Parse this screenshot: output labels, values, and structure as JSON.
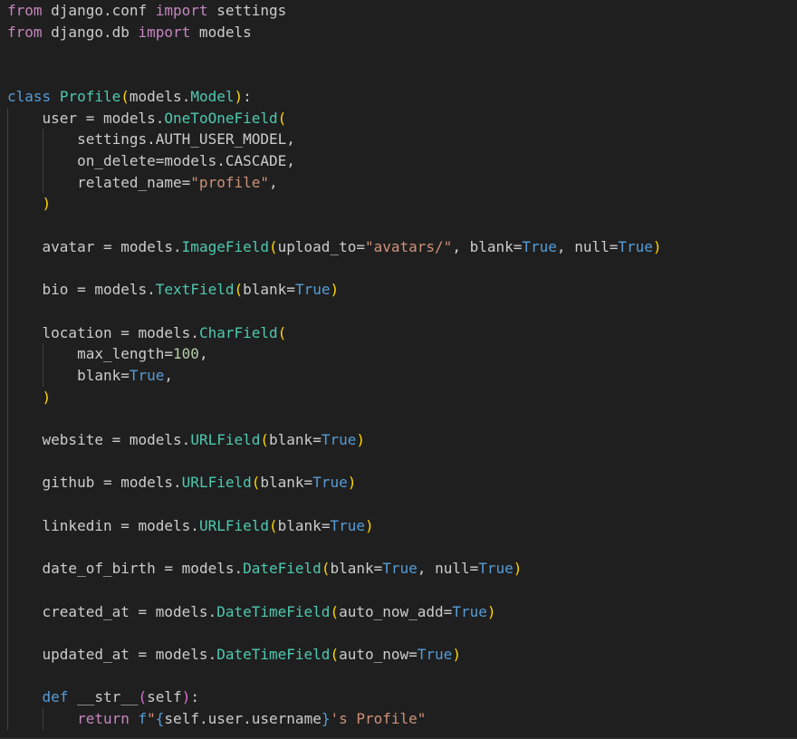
{
  "editor": {
    "colors": {
      "background": "#1f1f1f",
      "keyword": "#c586c0",
      "storage": "#569cd6",
      "text": "#cccccc",
      "variable": "#9cdcfe",
      "class_name": "#4ec9b0",
      "function": "#dcdcaa",
      "string": "#ce9178",
      "number": "#b5cea8",
      "bracket1": "#ffd700",
      "bracket2": "#da70d6",
      "indent_guide": "#404040"
    },
    "lines": [
      [
        [
          "from",
          "keyword"
        ],
        [
          " django.conf ",
          "text"
        ],
        [
          "import",
          "keyword"
        ],
        [
          " settings",
          "text"
        ]
      ],
      [
        [
          "from",
          "keyword"
        ],
        [
          " django.db ",
          "text"
        ],
        [
          "import",
          "keyword"
        ],
        [
          " models",
          "text"
        ]
      ],
      [],
      [],
      [
        [
          "class",
          "storage"
        ],
        [
          " ",
          "text"
        ],
        [
          "Profile",
          "class_name"
        ],
        [
          "(",
          "bracket1"
        ],
        [
          "models",
          "text"
        ],
        [
          ".",
          "text"
        ],
        [
          "Model",
          "class_name"
        ],
        [
          ")",
          "bracket1"
        ],
        [
          ":",
          "text"
        ]
      ],
      [
        [
          "    ",
          "text"
        ],
        [
          "user",
          "text"
        ],
        [
          " = ",
          "text"
        ],
        [
          "models",
          "text"
        ],
        [
          ".",
          "text"
        ],
        [
          "OneToOneField",
          "class_name"
        ],
        [
          "(",
          "bracket1"
        ]
      ],
      [
        [
          "        ",
          "text"
        ],
        [
          "settings",
          "text"
        ],
        [
          ".",
          "text"
        ],
        [
          "AUTH_USER_MODEL",
          "text"
        ],
        [
          ",",
          "text"
        ]
      ],
      [
        [
          "        ",
          "text"
        ],
        [
          "on_delete",
          "text"
        ],
        [
          "=",
          "text"
        ],
        [
          "models",
          "text"
        ],
        [
          ".",
          "text"
        ],
        [
          "CASCADE",
          "text"
        ],
        [
          ",",
          "text"
        ]
      ],
      [
        [
          "        ",
          "text"
        ],
        [
          "related_name",
          "text"
        ],
        [
          "=",
          "text"
        ],
        [
          "\"profile\"",
          "string"
        ],
        [
          ",",
          "text"
        ]
      ],
      [
        [
          "    ",
          "text"
        ],
        [
          ")",
          "bracket1"
        ]
      ],
      [],
      [
        [
          "    ",
          "text"
        ],
        [
          "avatar",
          "text"
        ],
        [
          " = ",
          "text"
        ],
        [
          "models",
          "text"
        ],
        [
          ".",
          "text"
        ],
        [
          "ImageField",
          "class_name"
        ],
        [
          "(",
          "bracket1"
        ],
        [
          "upload_to",
          "text"
        ],
        [
          "=",
          "text"
        ],
        [
          "\"avatars/\"",
          "string"
        ],
        [
          ", ",
          "text"
        ],
        [
          "blank",
          "text"
        ],
        [
          "=",
          "text"
        ],
        [
          "True",
          "storage"
        ],
        [
          ", ",
          "text"
        ],
        [
          "null",
          "text"
        ],
        [
          "=",
          "text"
        ],
        [
          "True",
          "storage"
        ],
        [
          ")",
          "bracket1"
        ]
      ],
      [],
      [
        [
          "    ",
          "text"
        ],
        [
          "bio",
          "text"
        ],
        [
          " = ",
          "text"
        ],
        [
          "models",
          "text"
        ],
        [
          ".",
          "text"
        ],
        [
          "TextField",
          "class_name"
        ],
        [
          "(",
          "bracket1"
        ],
        [
          "blank",
          "text"
        ],
        [
          "=",
          "text"
        ],
        [
          "True",
          "storage"
        ],
        [
          ")",
          "bracket1"
        ]
      ],
      [],
      [
        [
          "    ",
          "text"
        ],
        [
          "location",
          "text"
        ],
        [
          " = ",
          "text"
        ],
        [
          "models",
          "text"
        ],
        [
          ".",
          "text"
        ],
        [
          "CharField",
          "class_name"
        ],
        [
          "(",
          "bracket1"
        ]
      ],
      [
        [
          "        ",
          "text"
        ],
        [
          "max_length",
          "text"
        ],
        [
          "=",
          "text"
        ],
        [
          "100",
          "number"
        ],
        [
          ",",
          "text"
        ]
      ],
      [
        [
          "        ",
          "text"
        ],
        [
          "blank",
          "text"
        ],
        [
          "=",
          "text"
        ],
        [
          "True",
          "storage"
        ],
        [
          ",",
          "text"
        ]
      ],
      [
        [
          "    ",
          "text"
        ],
        [
          ")",
          "bracket1"
        ]
      ],
      [],
      [
        [
          "    ",
          "text"
        ],
        [
          "website",
          "text"
        ],
        [
          " = ",
          "text"
        ],
        [
          "models",
          "text"
        ],
        [
          ".",
          "text"
        ],
        [
          "URLField",
          "class_name"
        ],
        [
          "(",
          "bracket1"
        ],
        [
          "blank",
          "text"
        ],
        [
          "=",
          "text"
        ],
        [
          "True",
          "storage"
        ],
        [
          ")",
          "bracket1"
        ]
      ],
      [],
      [
        [
          "    ",
          "text"
        ],
        [
          "github",
          "text"
        ],
        [
          " = ",
          "text"
        ],
        [
          "models",
          "text"
        ],
        [
          ".",
          "text"
        ],
        [
          "URLField",
          "class_name"
        ],
        [
          "(",
          "bracket1"
        ],
        [
          "blank",
          "text"
        ],
        [
          "=",
          "text"
        ],
        [
          "True",
          "storage"
        ],
        [
          ")",
          "bracket1"
        ]
      ],
      [],
      [
        [
          "    ",
          "text"
        ],
        [
          "linkedin",
          "text"
        ],
        [
          " = ",
          "text"
        ],
        [
          "models",
          "text"
        ],
        [
          ".",
          "text"
        ],
        [
          "URLField",
          "class_name"
        ],
        [
          "(",
          "bracket1"
        ],
        [
          "blank",
          "text"
        ],
        [
          "=",
          "text"
        ],
        [
          "True",
          "storage"
        ],
        [
          ")",
          "bracket1"
        ]
      ],
      [],
      [
        [
          "    ",
          "text"
        ],
        [
          "date_of_birth",
          "text"
        ],
        [
          " = ",
          "text"
        ],
        [
          "models",
          "text"
        ],
        [
          ".",
          "text"
        ],
        [
          "DateField",
          "class_name"
        ],
        [
          "(",
          "bracket1"
        ],
        [
          "blank",
          "text"
        ],
        [
          "=",
          "text"
        ],
        [
          "True",
          "storage"
        ],
        [
          ", ",
          "text"
        ],
        [
          "null",
          "text"
        ],
        [
          "=",
          "text"
        ],
        [
          "True",
          "storage"
        ],
        [
          ")",
          "bracket1"
        ]
      ],
      [],
      [
        [
          "    ",
          "text"
        ],
        [
          "created_at",
          "text"
        ],
        [
          " = ",
          "text"
        ],
        [
          "models",
          "text"
        ],
        [
          ".",
          "text"
        ],
        [
          "DateTimeField",
          "class_name"
        ],
        [
          "(",
          "bracket1"
        ],
        [
          "auto_now_add",
          "text"
        ],
        [
          "=",
          "text"
        ],
        [
          "True",
          "storage"
        ],
        [
          ")",
          "bracket1"
        ]
      ],
      [],
      [
        [
          "    ",
          "text"
        ],
        [
          "updated_at",
          "text"
        ],
        [
          " = ",
          "text"
        ],
        [
          "models",
          "text"
        ],
        [
          ".",
          "text"
        ],
        [
          "DateTimeField",
          "class_name"
        ],
        [
          "(",
          "bracket1"
        ],
        [
          "auto_now",
          "text"
        ],
        [
          "=",
          "text"
        ],
        [
          "True",
          "storage"
        ],
        [
          ")",
          "bracket1"
        ]
      ],
      [],
      [
        [
          "    ",
          "text"
        ],
        [
          "def",
          "storage"
        ],
        [
          " ",
          "text"
        ],
        [
          "__str__",
          "text"
        ],
        [
          "(",
          "bracket2"
        ],
        [
          "self",
          "text"
        ],
        [
          ")",
          "bracket2"
        ],
        [
          ":",
          "text"
        ]
      ],
      [
        [
          "        ",
          "text"
        ],
        [
          "return",
          "keyword"
        ],
        [
          " ",
          "text"
        ],
        [
          "f",
          "storage"
        ],
        [
          "\"",
          "string"
        ],
        [
          "{",
          "storage"
        ],
        [
          "self",
          "text"
        ],
        [
          ".",
          "text"
        ],
        [
          "user",
          "text"
        ],
        [
          ".",
          "text"
        ],
        [
          "username",
          "text"
        ],
        [
          "}",
          "storage"
        ],
        [
          "'s Profile\"",
          "string"
        ]
      ]
    ]
  }
}
